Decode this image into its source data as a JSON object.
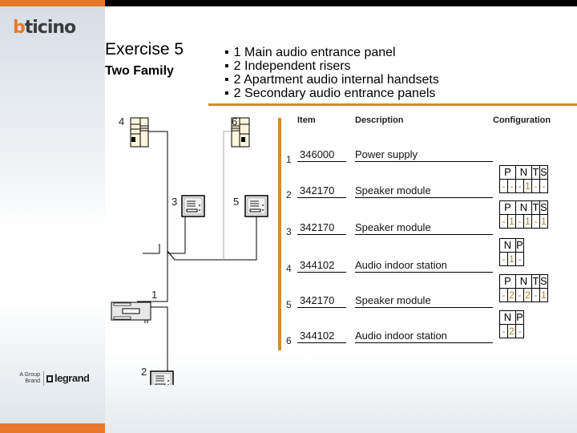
{
  "brand": {
    "logo_first": "b",
    "logo_rest": "ticino",
    "group_line1": "A Group",
    "group_line2": "Brand",
    "parent": "legrand"
  },
  "header": {
    "title": "Exercise 5",
    "subtitle": "Two Family",
    "bullets": [
      "1 Main audio entrance panel",
      "2 Independent risers",
      "2 Apartment audio internal handsets",
      "2 Secondary audio entrance panels"
    ]
  },
  "table": {
    "columns": [
      "Item",
      "Description",
      "Configuration"
    ],
    "rows": [
      {
        "num": "1",
        "item": "346000",
        "description": "Power supply",
        "config": null
      },
      {
        "num": "2",
        "item": "342170",
        "description": "Speaker module",
        "config": {
          "headers": [
            "P",
            "N",
            "T",
            "S"
          ],
          "values": [
            "-",
            "-",
            "-",
            "1",
            "-",
            "-"
          ]
        }
      },
      {
        "num": "3",
        "item": "342170",
        "description": "Speaker module",
        "config": {
          "headers": [
            "P",
            "N",
            "T",
            "S"
          ],
          "values": [
            "-",
            "1",
            "-",
            "1",
            "-",
            "1"
          ]
        }
      },
      {
        "num": "4",
        "item": "344102",
        "description": "Audio indoor station",
        "config": {
          "headers": [
            "N",
            "P"
          ],
          "values": [
            "-",
            "1",
            "-"
          ]
        }
      },
      {
        "num": "5",
        "item": "342170",
        "description": "Speaker module",
        "config": {
          "headers": [
            "P",
            "N",
            "T",
            "S"
          ],
          "values": [
            "-",
            "2",
            "-",
            "2",
            "-",
            "1"
          ]
        }
      },
      {
        "num": "6",
        "item": "344102",
        "description": "Audio indoor station",
        "config": {
          "headers": [
            "N",
            "P"
          ],
          "values": [
            "-",
            "2",
            "-"
          ]
        }
      }
    ]
  },
  "diagram": {
    "labels": [
      "1",
      "2",
      "3",
      "4",
      "5",
      "6"
    ],
    "components": {
      "1": "power-supply",
      "2": "main-entrance-panel",
      "3": "secondary-entrance-panel",
      "4": "audio-handset",
      "5": "secondary-entrance-panel",
      "6": "audio-handset"
    }
  }
}
